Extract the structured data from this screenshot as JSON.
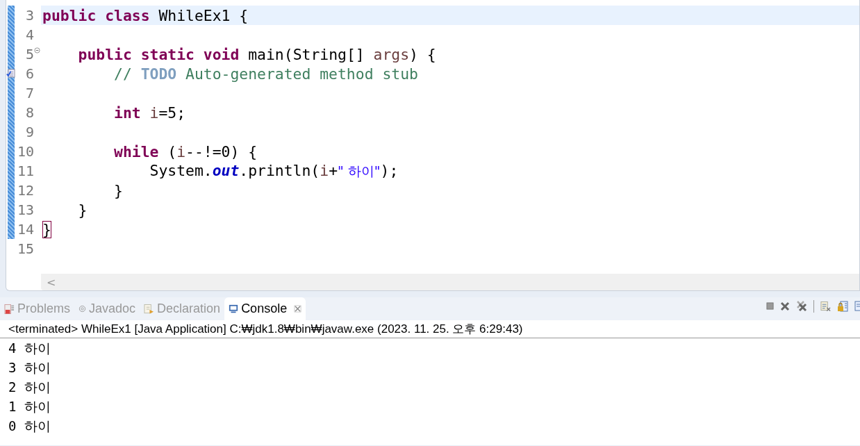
{
  "editor": {
    "lines": [
      {
        "number": "3",
        "current": true,
        "changed": true,
        "foldable": false,
        "task": false,
        "tokens": [
          {
            "kind": "keyword",
            "text": "public"
          },
          {
            "kind": "keyword",
            "text": " class"
          },
          {
            "kind": "plain",
            "text": " WhileEx1 {"
          }
        ]
      },
      {
        "number": "4",
        "current": false,
        "changed": true,
        "foldable": false,
        "task": false
      },
      {
        "number": "5",
        "current": false,
        "changed": true,
        "foldable": true,
        "task": false,
        "tokens": [
          {
            "kind": "keyword",
            "text": "    public"
          },
          {
            "kind": "keyword",
            "text": " static"
          },
          {
            "kind": "keyword",
            "text": " void"
          },
          {
            "kind": "plain",
            "text": " main(String[] "
          },
          {
            "kind": "param",
            "text": "args"
          },
          {
            "kind": "plain",
            "text": ") {"
          }
        ]
      },
      {
        "number": "6",
        "current": false,
        "changed": true,
        "foldable": false,
        "task": true,
        "tokens": [
          {
            "kind": "comment",
            "text": "        // "
          },
          {
            "kind": "task",
            "text": "TODO"
          },
          {
            "kind": "comment",
            "text": " Auto-generated method stub"
          }
        ]
      },
      {
        "number": "7",
        "current": false,
        "changed": true,
        "foldable": false,
        "task": false
      },
      {
        "number": "8",
        "current": false,
        "changed": true,
        "foldable": false,
        "task": false,
        "tokens": [
          {
            "kind": "keyword",
            "text": "        int"
          },
          {
            "kind": "local",
            "text": " i"
          },
          {
            "kind": "plain",
            "text": "=5;"
          }
        ]
      },
      {
        "number": "9",
        "current": false,
        "changed": true,
        "foldable": false,
        "task": false
      },
      {
        "number": "10",
        "current": false,
        "changed": true,
        "foldable": false,
        "task": false,
        "tokens": [
          {
            "kind": "keyword",
            "text": "        while"
          },
          {
            "kind": "plain",
            "text": " ("
          },
          {
            "kind": "local",
            "text": "i"
          },
          {
            "kind": "plain",
            "text": "--!=0) {"
          }
        ]
      },
      {
        "number": "11",
        "current": false,
        "changed": true,
        "foldable": false,
        "task": false,
        "tokens": [
          {
            "kind": "plain",
            "text": "            System."
          },
          {
            "kind": "field",
            "text": "out"
          },
          {
            "kind": "plain",
            "text": ".println("
          },
          {
            "kind": "local",
            "text": "i"
          },
          {
            "kind": "plain",
            "text": "+"
          },
          {
            "kind": "string",
            "text": "\" 하이\""
          },
          {
            "kind": "plain",
            "text": ");"
          }
        ]
      },
      {
        "number": "12",
        "current": false,
        "changed": true,
        "foldable": false,
        "task": false,
        "tokens": [
          {
            "kind": "plain",
            "text": "        }"
          }
        ]
      },
      {
        "number": "13",
        "current": false,
        "changed": true,
        "foldable": false,
        "task": false,
        "tokens": [
          {
            "kind": "plain",
            "text": "    }"
          }
        ]
      },
      {
        "number": "14",
        "current": false,
        "changed": true,
        "foldable": false,
        "task": false,
        "tokens": [
          {
            "kind": "bracket",
            "text": "}"
          }
        ]
      },
      {
        "number": "15",
        "current": false,
        "changed": false,
        "foldable": false,
        "task": false
      }
    ],
    "scroll_left": "<"
  },
  "views": {
    "tabs": [
      {
        "label": "Problems",
        "selected": false
      },
      {
        "label": "Javadoc",
        "selected": false
      },
      {
        "label": "Declaration",
        "selected": false
      },
      {
        "label": "Console",
        "selected": true
      }
    ]
  },
  "console": {
    "header": "<terminated> WhileEx1 [Java Application] C:₩jdk1.8₩bin₩javaw.exe (2023. 11. 25. 오후 6:29:43)",
    "output": [
      "4 하이",
      "3 하이",
      "2 하이",
      "1 하이",
      "0 하이"
    ]
  }
}
